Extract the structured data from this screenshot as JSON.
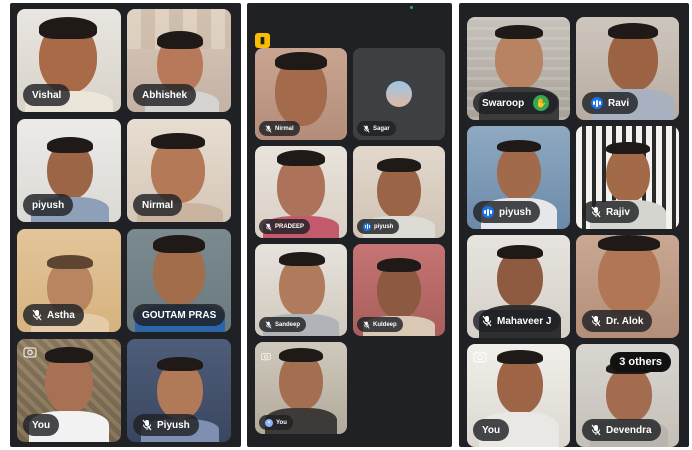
{
  "panels": [
    {
      "tiles": [
        {
          "name": "Vishal",
          "mic": "none"
        },
        {
          "name": "Abhishek",
          "mic": "none"
        },
        {
          "name": "piyush",
          "mic": "none"
        },
        {
          "name": "Nirmal",
          "mic": "none",
          "active": true
        },
        {
          "name": "Astha",
          "mic": "muted"
        },
        {
          "name": "GOUTAM PRAS",
          "mic": "none"
        },
        {
          "name": "You",
          "mic": "none",
          "camera_off_icon": true
        },
        {
          "name": "Piyush",
          "mic": "muted"
        }
      ]
    },
    {
      "tiles": [
        {
          "name": "Nirmal",
          "mic": "muted"
        },
        {
          "name": "Sagar",
          "mic": "muted",
          "avatar": true
        },
        {
          "name": "PRADEEP",
          "mic": "muted"
        },
        {
          "name": "piyush",
          "mic": "speaking"
        },
        {
          "name": "Sandeep",
          "mic": "muted"
        },
        {
          "name": "Kuldeep",
          "mic": "muted"
        },
        {
          "name": "You",
          "mic": "more"
        }
      ]
    },
    {
      "tiles": [
        {
          "name": "Swaroop",
          "mic": "none",
          "hand_raised": true
        },
        {
          "name": "Ravi",
          "mic": "speaking"
        },
        {
          "name": "piyush",
          "mic": "speaking"
        },
        {
          "name": "Rajiv",
          "mic": "muted"
        },
        {
          "name": "Mahaveer J",
          "mic": "muted"
        },
        {
          "name": "Dr. Alok",
          "mic": "muted"
        },
        {
          "name": "You",
          "mic": "none"
        },
        {
          "name": "Devendra",
          "mic": "muted",
          "others_label": "3 others"
        }
      ]
    }
  ],
  "icons": {
    "mic_muted": "mic-off-icon",
    "speaking": "audio-wave-icon",
    "hand": "raised-hand-icon",
    "camera_off": "camera-off-icon",
    "badge": "host-badge-icon"
  },
  "colors": {
    "background": "#202124",
    "tile": "#3c4043",
    "active_border": "#8ab4f8",
    "speaking": "#1a73e8",
    "hand": "#34a853",
    "badge": "#fbbc04"
  }
}
